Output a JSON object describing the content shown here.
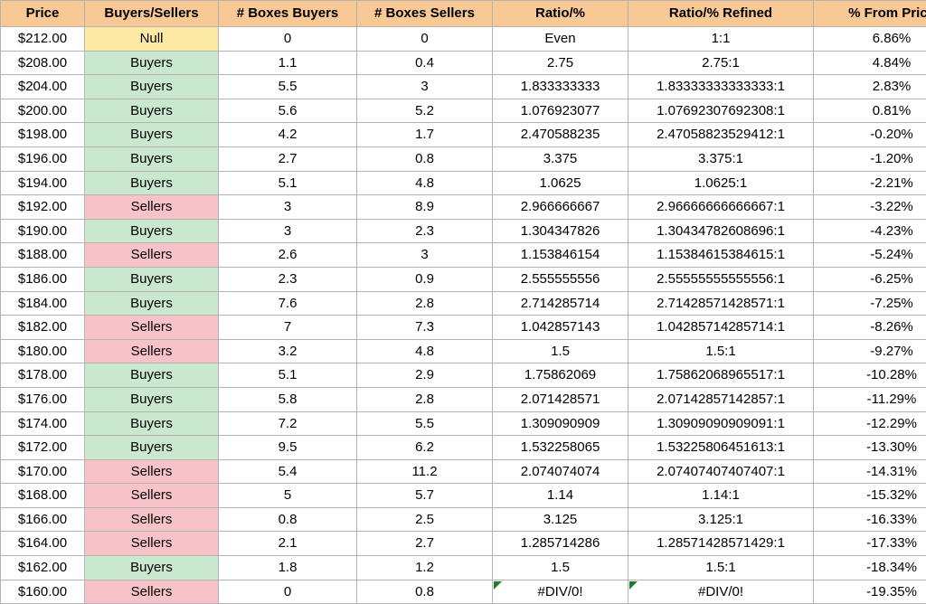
{
  "table": {
    "columns": [
      "Price",
      "Buyers/Sellers",
      "# Boxes Buyers",
      "# Boxes Sellers",
      "Ratio/%",
      "Ratio/% Refined",
      "% From Price"
    ],
    "rows": [
      {
        "price": "$212.00",
        "side": "Null",
        "boxes_buyers": "0",
        "boxes_sellers": "0",
        "ratio": "Even",
        "ratio_refined": "1:1",
        "pct_from_price": "6.86%",
        "error": false
      },
      {
        "price": "$208.00",
        "side": "Buyers",
        "boxes_buyers": "1.1",
        "boxes_sellers": "0.4",
        "ratio": "2.75",
        "ratio_refined": "2.75:1",
        "pct_from_price": "4.84%",
        "error": false
      },
      {
        "price": "$204.00",
        "side": "Buyers",
        "boxes_buyers": "5.5",
        "boxes_sellers": "3",
        "ratio": "1.833333333",
        "ratio_refined": "1.83333333333333:1",
        "pct_from_price": "2.83%",
        "error": false
      },
      {
        "price": "$200.00",
        "side": "Buyers",
        "boxes_buyers": "5.6",
        "boxes_sellers": "5.2",
        "ratio": "1.076923077",
        "ratio_refined": "1.07692307692308:1",
        "pct_from_price": "0.81%",
        "error": false
      },
      {
        "price": "$198.00",
        "side": "Buyers",
        "boxes_buyers": "4.2",
        "boxes_sellers": "1.7",
        "ratio": "2.470588235",
        "ratio_refined": "2.47058823529412:1",
        "pct_from_price": "-0.20%",
        "error": false
      },
      {
        "price": "$196.00",
        "side": "Buyers",
        "boxes_buyers": "2.7",
        "boxes_sellers": "0.8",
        "ratio": "3.375",
        "ratio_refined": "3.375:1",
        "pct_from_price": "-1.20%",
        "error": false
      },
      {
        "price": "$194.00",
        "side": "Buyers",
        "boxes_buyers": "5.1",
        "boxes_sellers": "4.8",
        "ratio": "1.0625",
        "ratio_refined": "1.0625:1",
        "pct_from_price": "-2.21%",
        "error": false
      },
      {
        "price": "$192.00",
        "side": "Sellers",
        "boxes_buyers": "3",
        "boxes_sellers": "8.9",
        "ratio": "2.966666667",
        "ratio_refined": "2.96666666666667:1",
        "pct_from_price": "-3.22%",
        "error": false
      },
      {
        "price": "$190.00",
        "side": "Buyers",
        "boxes_buyers": "3",
        "boxes_sellers": "2.3",
        "ratio": "1.304347826",
        "ratio_refined": "1.30434782608696:1",
        "pct_from_price": "-4.23%",
        "error": false
      },
      {
        "price": "$188.00",
        "side": "Sellers",
        "boxes_buyers": "2.6",
        "boxes_sellers": "3",
        "ratio": "1.153846154",
        "ratio_refined": "1.15384615384615:1",
        "pct_from_price": "-5.24%",
        "error": false
      },
      {
        "price": "$186.00",
        "side": "Buyers",
        "boxes_buyers": "2.3",
        "boxes_sellers": "0.9",
        "ratio": "2.555555556",
        "ratio_refined": "2.55555555555556:1",
        "pct_from_price": "-6.25%",
        "error": false
      },
      {
        "price": "$184.00",
        "side": "Buyers",
        "boxes_buyers": "7.6",
        "boxes_sellers": "2.8",
        "ratio": "2.714285714",
        "ratio_refined": "2.71428571428571:1",
        "pct_from_price": "-7.25%",
        "error": false
      },
      {
        "price": "$182.00",
        "side": "Sellers",
        "boxes_buyers": "7",
        "boxes_sellers": "7.3",
        "ratio": "1.042857143",
        "ratio_refined": "1.04285714285714:1",
        "pct_from_price": "-8.26%",
        "error": false
      },
      {
        "price": "$180.00",
        "side": "Sellers",
        "boxes_buyers": "3.2",
        "boxes_sellers": "4.8",
        "ratio": "1.5",
        "ratio_refined": "1.5:1",
        "pct_from_price": "-9.27%",
        "error": false
      },
      {
        "price": "$178.00",
        "side": "Buyers",
        "boxes_buyers": "5.1",
        "boxes_sellers": "2.9",
        "ratio": "1.75862069",
        "ratio_refined": "1.75862068965517:1",
        "pct_from_price": "-10.28%",
        "error": false
      },
      {
        "price": "$176.00",
        "side": "Buyers",
        "boxes_buyers": "5.8",
        "boxes_sellers": "2.8",
        "ratio": "2.071428571",
        "ratio_refined": "2.07142857142857:1",
        "pct_from_price": "-11.29%",
        "error": false
      },
      {
        "price": "$174.00",
        "side": "Buyers",
        "boxes_buyers": "7.2",
        "boxes_sellers": "5.5",
        "ratio": "1.309090909",
        "ratio_refined": "1.30909090909091:1",
        "pct_from_price": "-12.29%",
        "error": false
      },
      {
        "price": "$172.00",
        "side": "Buyers",
        "boxes_buyers": "9.5",
        "boxes_sellers": "6.2",
        "ratio": "1.532258065",
        "ratio_refined": "1.53225806451613:1",
        "pct_from_price": "-13.30%",
        "error": false
      },
      {
        "price": "$170.00",
        "side": "Sellers",
        "boxes_buyers": "5.4",
        "boxes_sellers": "11.2",
        "ratio": "2.074074074",
        "ratio_refined": "2.07407407407407:1",
        "pct_from_price": "-14.31%",
        "error": false
      },
      {
        "price": "$168.00",
        "side": "Sellers",
        "boxes_buyers": "5",
        "boxes_sellers": "5.7",
        "ratio": "1.14",
        "ratio_refined": "1.14:1",
        "pct_from_price": "-15.32%",
        "error": false
      },
      {
        "price": "$166.00",
        "side": "Sellers",
        "boxes_buyers": "0.8",
        "boxes_sellers": "2.5",
        "ratio": "3.125",
        "ratio_refined": "3.125:1",
        "pct_from_price": "-16.33%",
        "error": false
      },
      {
        "price": "$164.00",
        "side": "Sellers",
        "boxes_buyers": "2.1",
        "boxes_sellers": "2.7",
        "ratio": "1.285714286",
        "ratio_refined": "1.28571428571429:1",
        "pct_from_price": "-17.33%",
        "error": false
      },
      {
        "price": "$162.00",
        "side": "Buyers",
        "boxes_buyers": "1.8",
        "boxes_sellers": "1.2",
        "ratio": "1.5",
        "ratio_refined": "1.5:1",
        "pct_from_price": "-18.34%",
        "error": false
      },
      {
        "price": "$160.00",
        "side": "Sellers",
        "boxes_buyers": "0",
        "boxes_sellers": "0.8",
        "ratio": "#DIV/0!",
        "ratio_refined": "#DIV/0!",
        "pct_from_price": "-19.35%",
        "error": true
      }
    ]
  },
  "colors": {
    "header_bg": "#f8c895",
    "buyers_bg": "#c9e8ce",
    "sellers_bg": "#f8c2c9",
    "null_bg": "#fdeba5",
    "grid": "#b3b3b3",
    "comment_marker": "#1e7c31"
  }
}
